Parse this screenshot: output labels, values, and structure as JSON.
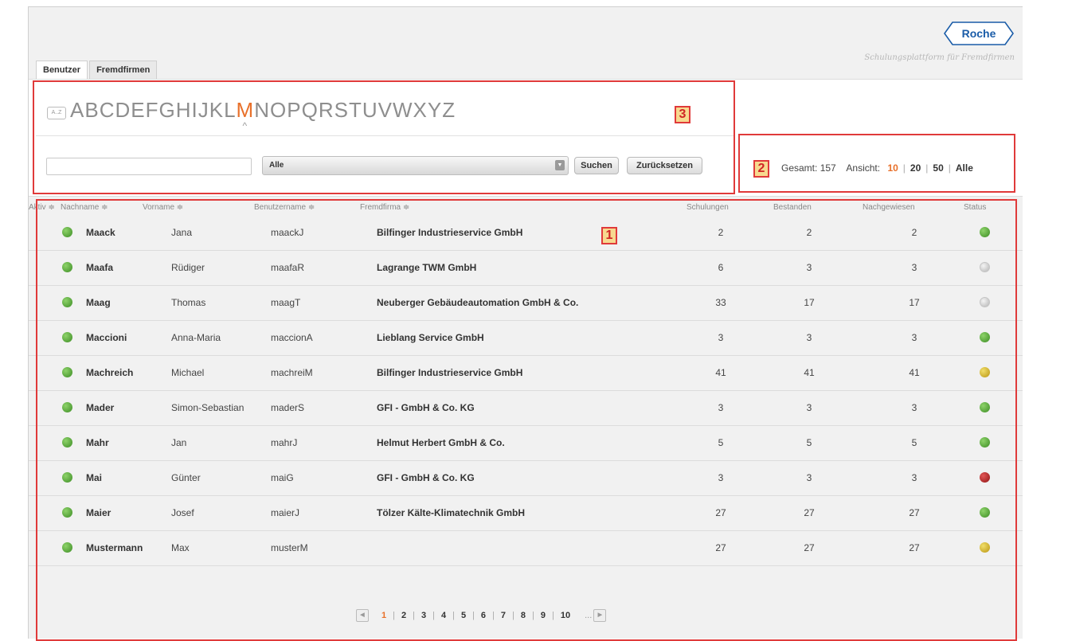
{
  "brand": {
    "logo_text": "Roche",
    "tagline": "Schulungsplattform für Fremdfirmen"
  },
  "tabs": [
    {
      "label": "Benutzer",
      "active": true
    },
    {
      "label": "Fremdfirmen",
      "active": false
    }
  ],
  "alphabet": {
    "icon_label": "A..Z",
    "letters": [
      "A",
      "B",
      "C",
      "D",
      "E",
      "F",
      "G",
      "H",
      "I",
      "J",
      "K",
      "L",
      "M",
      "N",
      "O",
      "P",
      "Q",
      "R",
      "S",
      "T",
      "U",
      "V",
      "W",
      "X",
      "Y",
      "Z"
    ],
    "active": "M"
  },
  "search": {
    "value": "",
    "select_value": "Alle",
    "search_label": "Suchen",
    "reset_label": "Zurücksetzen"
  },
  "summary": {
    "total_label": "Gesamt:",
    "total": "157",
    "view_label": "Ansicht:",
    "options": [
      "10",
      "20",
      "50",
      "Alle"
    ],
    "active_option": "10"
  },
  "annotations": {
    "one": "1",
    "two": "2",
    "three": "3"
  },
  "table": {
    "headers": {
      "aktiv": "Aktiv ≑",
      "nachname": "Nachname ≑",
      "vorname": "Vorname ≑",
      "benutzername": "Benutzername ≑",
      "fremdfirma": "Fremdfirma ≑",
      "schulungen": "Schulungen",
      "bestanden": "Bestanden",
      "nachgewiesen": "Nachgewiesen",
      "status": "Status"
    },
    "rows": [
      {
        "nachname": "Maack",
        "vorname": "Jana",
        "benutzer": "maackJ",
        "firma": "Bilfinger Industrieservice GmbH",
        "schulungen": "2",
        "bestanden": "2",
        "nachgewiesen": "2",
        "status": "green"
      },
      {
        "nachname": "Maafa",
        "vorname": "Rüdiger",
        "benutzer": "maafaR",
        "firma": "Lagrange TWM GmbH",
        "schulungen": "6",
        "bestanden": "3",
        "nachgewiesen": "3",
        "status": "gray"
      },
      {
        "nachname": "Maag",
        "vorname": "Thomas",
        "benutzer": "maagT",
        "firma": "Neuberger Gebäudeautomation GmbH & Co.",
        "schulungen": "33",
        "bestanden": "17",
        "nachgewiesen": "17",
        "status": "gray"
      },
      {
        "nachname": "Maccioni",
        "vorname": "Anna-Maria",
        "benutzer": "maccionA",
        "firma": "Lieblang Service GmbH",
        "schulungen": "3",
        "bestanden": "3",
        "nachgewiesen": "3",
        "status": "green"
      },
      {
        "nachname": "Machreich",
        "vorname": "Michael",
        "benutzer": "machreiM",
        "firma": "Bilfinger Industrieservice GmbH",
        "schulungen": "41",
        "bestanden": "41",
        "nachgewiesen": "41",
        "status": "yellow"
      },
      {
        "nachname": "Mader",
        "vorname": "Simon-Sebastian",
        "benutzer": "maderS",
        "firma": "GFI - GmbH & Co. KG",
        "schulungen": "3",
        "bestanden": "3",
        "nachgewiesen": "3",
        "status": "green"
      },
      {
        "nachname": "Mahr",
        "vorname": "Jan",
        "benutzer": "mahrJ",
        "firma": "Helmut Herbert GmbH & Co.",
        "schulungen": "5",
        "bestanden": "5",
        "nachgewiesen": "5",
        "status": "green"
      },
      {
        "nachname": "Mai",
        "vorname": "Günter",
        "benutzer": "maiG",
        "firma": "GFI - GmbH & Co. KG",
        "schulungen": "3",
        "bestanden": "3",
        "nachgewiesen": "3",
        "status": "red"
      },
      {
        "nachname": "Maier",
        "vorname": "Josef",
        "benutzer": "maierJ",
        "firma": "Tölzer Kälte-Klimatechnik GmbH",
        "schulungen": "27",
        "bestanden": "27",
        "nachgewiesen": "27",
        "status": "green"
      },
      {
        "nachname": "Mustermann",
        "vorname": "Max",
        "benutzer": "musterM",
        "firma": "",
        "schulungen": "27",
        "bestanden": "27",
        "nachgewiesen": "27",
        "status": "yellow"
      }
    ]
  },
  "pagination": {
    "pages": [
      "1",
      "2",
      "3",
      "4",
      "5",
      "6",
      "7",
      "8",
      "9",
      "10"
    ],
    "active": "1",
    "ellipsis": "..."
  },
  "colors": {
    "accent": "#e8702a",
    "annotation": "#e03a3a",
    "status_green": "#4a9a2f",
    "status_yellow": "#c9a81f",
    "status_red": "#a51a1a",
    "status_gray": "#cccccc"
  }
}
